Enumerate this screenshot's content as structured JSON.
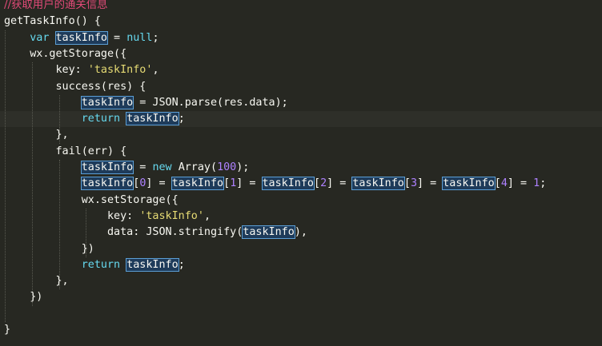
{
  "editor": {
    "lines": [
      {
        "indent": 0,
        "tokens": [
          {
            "t": "//获取用户的通关信息",
            "c": "cm"
          }
        ]
      },
      {
        "indent": 0,
        "tokens": [
          {
            "t": "getTaskInfo() {"
          }
        ]
      },
      {
        "indent": 4,
        "tokens": [
          {
            "t": "var ",
            "c": "kw"
          },
          {
            "t": "taskInfo",
            "h": 1
          },
          {
            "t": " = "
          },
          {
            "t": "null",
            "c": "kw"
          },
          {
            "t": ";"
          }
        ]
      },
      {
        "indent": 4,
        "tokens": [
          {
            "t": "wx.getStorage({"
          }
        ]
      },
      {
        "indent": 8,
        "tokens": [
          {
            "t": "key: "
          },
          {
            "t": "'taskInfo'",
            "c": "str"
          },
          {
            "t": ","
          }
        ]
      },
      {
        "indent": 8,
        "tokens": [
          {
            "t": "success(res) {"
          }
        ]
      },
      {
        "indent": 12,
        "tokens": [
          {
            "t": "taskInfo",
            "h": 1
          },
          {
            "t": " = JSON.parse(res.data);"
          }
        ]
      },
      {
        "indent": 12,
        "tokens": [
          {
            "t": "return ",
            "c": "kw"
          },
          {
            "t": "taskInfo",
            "h": 1
          },
          {
            "t": ";"
          }
        ],
        "cursor": true
      },
      {
        "indent": 8,
        "tokens": [
          {
            "t": "},"
          }
        ]
      },
      {
        "indent": 8,
        "tokens": [
          {
            "t": "fail(err) {"
          }
        ]
      },
      {
        "indent": 12,
        "tokens": [
          {
            "t": "taskInfo",
            "h": 1
          },
          {
            "t": " = "
          },
          {
            "t": "new ",
            "c": "kw"
          },
          {
            "t": "Array("
          },
          {
            "t": "100",
            "c": "num"
          },
          {
            "t": ");"
          }
        ]
      },
      {
        "indent": 12,
        "tokens": [
          {
            "t": "taskInfo",
            "h": 1
          },
          {
            "t": "["
          },
          {
            "t": "0",
            "c": "num"
          },
          {
            "t": "] = "
          },
          {
            "t": "taskInfo",
            "h": 1
          },
          {
            "t": "["
          },
          {
            "t": "1",
            "c": "num"
          },
          {
            "t": "] = "
          },
          {
            "t": "taskInfo",
            "h": 1
          },
          {
            "t": "["
          },
          {
            "t": "2",
            "c": "num"
          },
          {
            "t": "] = "
          },
          {
            "t": "taskInfo",
            "h": 1
          },
          {
            "t": "["
          },
          {
            "t": "3",
            "c": "num"
          },
          {
            "t": "] = "
          },
          {
            "t": "taskInfo",
            "h": 1
          },
          {
            "t": "["
          },
          {
            "t": "4",
            "c": "num"
          },
          {
            "t": "] = "
          },
          {
            "t": "1",
            "c": "num"
          },
          {
            "t": ";"
          }
        ]
      },
      {
        "indent": 12,
        "tokens": [
          {
            "t": "wx.setStorage({"
          }
        ]
      },
      {
        "indent": 16,
        "tokens": [
          {
            "t": "key: "
          },
          {
            "t": "'taskInfo'",
            "c": "str"
          },
          {
            "t": ","
          }
        ]
      },
      {
        "indent": 16,
        "tokens": [
          {
            "t": "data: JSON.stringify("
          },
          {
            "t": "taskInfo",
            "h": 1
          },
          {
            "t": "),"
          }
        ]
      },
      {
        "indent": 12,
        "tokens": [
          {
            "t": "})"
          }
        ]
      },
      {
        "indent": 12,
        "tokens": [
          {
            "t": "return ",
            "c": "kw"
          },
          {
            "t": "taskInfo",
            "h": 1
          },
          {
            "t": ";"
          }
        ]
      },
      {
        "indent": 8,
        "tokens": [
          {
            "t": "},"
          }
        ]
      },
      {
        "indent": 4,
        "tokens": [
          {
            "t": "})"
          }
        ]
      },
      {
        "indent": 0,
        "tokens": []
      },
      {
        "indent": 0,
        "tokens": [
          {
            "t": "}"
          }
        ]
      }
    ]
  },
  "colors": {
    "background": "#272822",
    "comment": "#e14a78",
    "keyword": "#66d9ef",
    "string": "#e6db74",
    "number": "#ae81ff",
    "highlight_border": "#5c9fd6",
    "highlight_fill": "#1e3b5a"
  }
}
